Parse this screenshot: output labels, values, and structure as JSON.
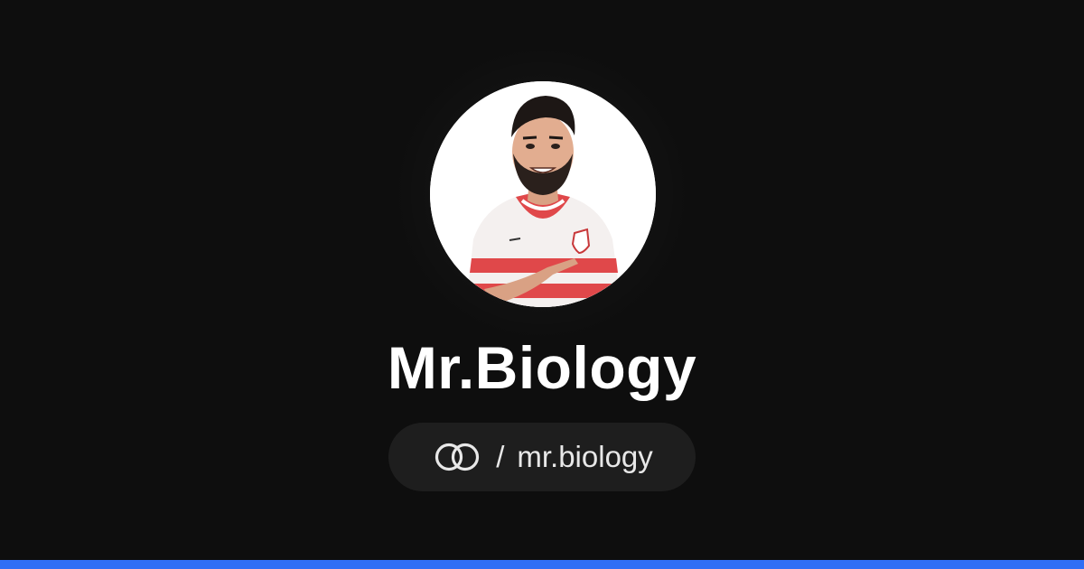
{
  "profile": {
    "name": "Mr.Biology",
    "separator": "/",
    "handle": "mr.biology"
  },
  "icons": {
    "link": "linked-rings-icon"
  },
  "colors": {
    "background": "#0e0e0e",
    "pill": "#1e1e1e",
    "accent": "#2f6ef5",
    "text": "#ffffff"
  }
}
